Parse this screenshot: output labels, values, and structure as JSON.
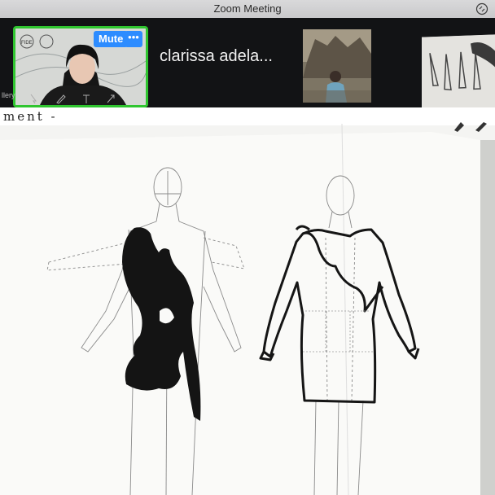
{
  "window": {
    "title": "Zoom Meeting"
  },
  "participants": {
    "active_tile": {
      "mute_label": "Mute",
      "more_label": "•••",
      "logo_text": "FIDE"
    },
    "name_label": "clarissa adela..."
  },
  "toolbar": {
    "label": "llery",
    "icons": [
      "pointer-icon",
      "pen-icon",
      "text-icon",
      "arrow-icon"
    ]
  },
  "document": {
    "title": "ment -"
  },
  "colors": {
    "active_speaker_border": "#2fc52f",
    "mute_button": "#2d8cff",
    "titlebar": "#d2d2d4"
  }
}
